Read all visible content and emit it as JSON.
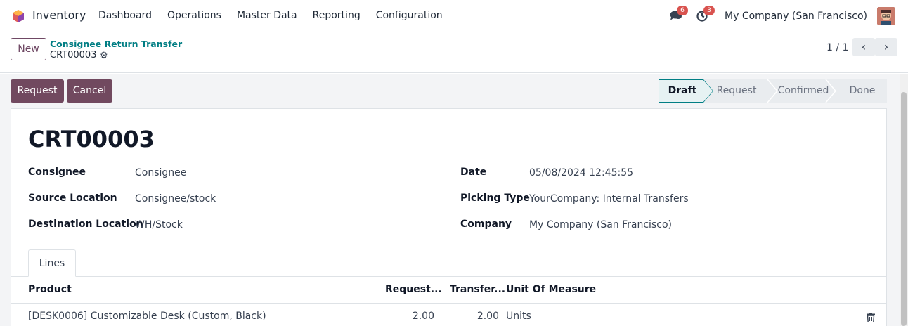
{
  "navbar": {
    "app_name": "Inventory",
    "menu": [
      "Dashboard",
      "Operations",
      "Master Data",
      "Reporting",
      "Configuration"
    ],
    "messages_count": "6",
    "activities_count": "3",
    "company": "My Company (San Francisco)"
  },
  "control_panel": {
    "new_label": "New",
    "breadcrumb_parent": "Consignee Return Transfer",
    "breadcrumb_current": "CRT00003",
    "pager": "1 / 1"
  },
  "actions": {
    "request_label": "Request",
    "cancel_label": "Cancel"
  },
  "statusbar": {
    "steps": [
      "Draft",
      "Request",
      "Confirmed",
      "Done"
    ],
    "active": "Draft"
  },
  "form": {
    "name": "CRT00003",
    "consignee_label": "Consignee",
    "consignee_value": "Consignee",
    "source_label": "Source Location",
    "source_value": "Consignee/stock",
    "destination_label": "Destination Location",
    "destination_value": "WH/Stock",
    "date_label": "Date",
    "date_value": "05/08/2024 12:45:55",
    "picking_type_label": "Picking Type",
    "picking_type_value": "YourCompany: Internal Transfers",
    "company_label": "Company",
    "company_value": "My Company (San Francisco)"
  },
  "tabs": {
    "lines": "Lines"
  },
  "lines_table": {
    "headers": {
      "product": "Product",
      "requested": "Request...",
      "transferred": "Transfer...",
      "uom": "Unit Of Measure"
    },
    "rows": [
      {
        "product": "[DESK0006] Customizable Desk (Custom, Black)",
        "requested": "2.00",
        "transferred": "2.00",
        "uom": "Units"
      }
    ]
  },
  "colors": {
    "primary": "#71495f",
    "link": "#017e84",
    "badge": "#d9534f",
    "status_active_bg": "#e6f2f3",
    "status_active_border": "#017e84"
  },
  "icons": {
    "app_logo": "inventory-logo-icon",
    "messages": "chat-icon",
    "activities": "clock-icon",
    "settings": "gear-icon",
    "pager_prev": "chevron-left-icon",
    "pager_next": "chevron-right-icon",
    "delete": "trash-icon"
  }
}
